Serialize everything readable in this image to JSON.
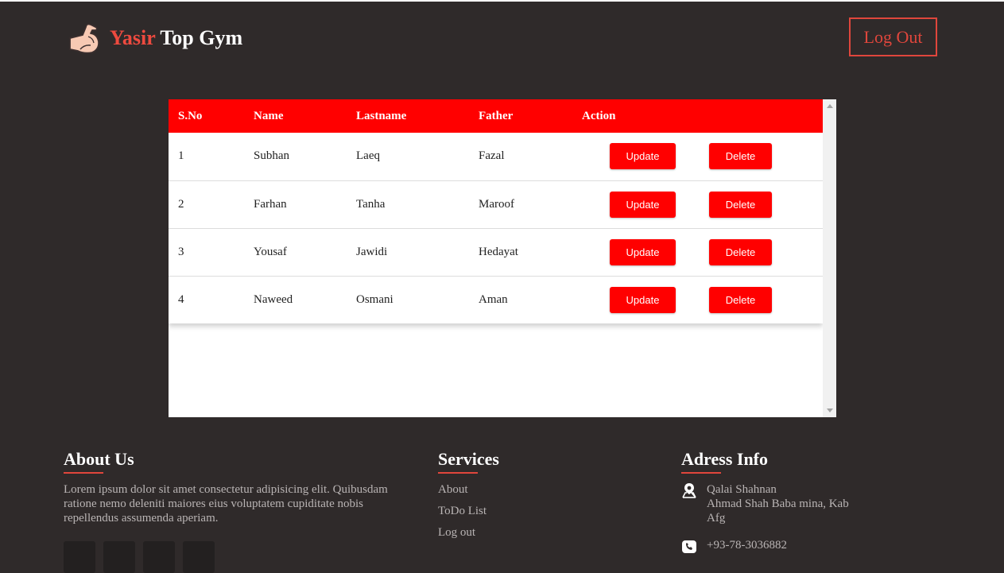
{
  "header": {
    "brand_first": "Yasir",
    "brand_rest": "Top Gym",
    "logo_icon": "flexed-bicep-icon",
    "logout_label": "Log Out"
  },
  "table": {
    "columns": [
      "S.No",
      "Name",
      "Lastname",
      "Father",
      "Action"
    ],
    "rows": [
      {
        "sno": "1",
        "name": "Subhan",
        "lastname": "Laeq",
        "father": "Fazal",
        "update": "Update",
        "delete": "Delete"
      },
      {
        "sno": "2",
        "name": "Farhan",
        "lastname": "Tanha",
        "father": "Maroof",
        "update": "Update",
        "delete": "Delete"
      },
      {
        "sno": "3",
        "name": "Yousaf",
        "lastname": "Jawidi",
        "father": "Hedayat",
        "update": "Update",
        "delete": "Delete"
      },
      {
        "sno": "4",
        "name": "Naweed",
        "lastname": "Osmani",
        "father": "Aman",
        "update": "Update",
        "delete": "Delete"
      }
    ]
  },
  "footer": {
    "about": {
      "heading": "About Us",
      "text": "Lorem ipsum dolor sit amet consectetur adipisicing elit. Quibusdam ratione nemo deleniti maiores eius voluptatem cupiditate nobis repellendus assumenda aperiam."
    },
    "services": {
      "heading": "Services",
      "links": [
        "About",
        "ToDo List",
        "Log out"
      ]
    },
    "address": {
      "heading": "Adress Info",
      "line1": "Qalai Shahnan",
      "line2": "Ahmad Shah Baba mina, Kab",
      "line3": "Afg",
      "phone": "+93-78-3036882",
      "location_icon": "map-pin-icon",
      "phone_icon": "phone-icon"
    }
  },
  "colors": {
    "background": "#2f2a2a",
    "accent": "#ee4a3f",
    "table_header": "#ff0000",
    "button": "#ff0000"
  }
}
